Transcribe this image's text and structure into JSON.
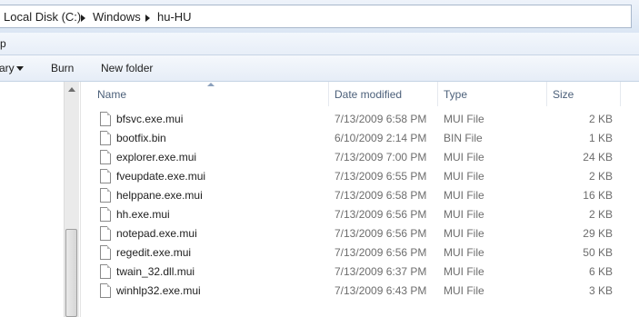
{
  "address": {
    "crumbs": [
      "Local Disk (C:)",
      "Windows",
      "hu-HU"
    ]
  },
  "menubar": {
    "partial_label": "p"
  },
  "toolbar": {
    "partial_label": "ary",
    "burn": "Burn",
    "new_folder": "New folder"
  },
  "columns": {
    "name": "Name",
    "date": "Date modified",
    "type": "Type",
    "size": "Size"
  },
  "files": [
    {
      "name": "bfsvc.exe.mui",
      "date": "7/13/2009 6:58 PM",
      "type": "MUI File",
      "size": "2 KB"
    },
    {
      "name": "bootfix.bin",
      "date": "6/10/2009 2:14 PM",
      "type": "BIN File",
      "size": "1 KB"
    },
    {
      "name": "explorer.exe.mui",
      "date": "7/13/2009 7:00 PM",
      "type": "MUI File",
      "size": "24 KB"
    },
    {
      "name": "fveupdate.exe.mui",
      "date": "7/13/2009 6:55 PM",
      "type": "MUI File",
      "size": "2 KB"
    },
    {
      "name": "helppane.exe.mui",
      "date": "7/13/2009 6:58 PM",
      "type": "MUI File",
      "size": "16 KB"
    },
    {
      "name": "hh.exe.mui",
      "date": "7/13/2009 6:56 PM",
      "type": "MUI File",
      "size": "2 KB"
    },
    {
      "name": "notepad.exe.mui",
      "date": "7/13/2009 6:56 PM",
      "type": "MUI File",
      "size": "29 KB"
    },
    {
      "name": "regedit.exe.mui",
      "date": "7/13/2009 6:56 PM",
      "type": "MUI File",
      "size": "50 KB"
    },
    {
      "name": "twain_32.dll.mui",
      "date": "7/13/2009 6:37 PM",
      "type": "MUI File",
      "size": "6 KB"
    },
    {
      "name": "winhlp32.exe.mui",
      "date": "7/13/2009 6:43 PM",
      "type": "MUI File",
      "size": "3 KB"
    }
  ],
  "icons": {
    "file": "document-icon",
    "breadcrumb_separator": "chevron-right-icon",
    "dropdown": "chevron-down-icon",
    "sort": "sort-ascending-icon"
  },
  "colors": {
    "header_text": "#4c607a",
    "toolbar_bg": "#e6edf7",
    "secondary_text": "#6d6d6d"
  }
}
